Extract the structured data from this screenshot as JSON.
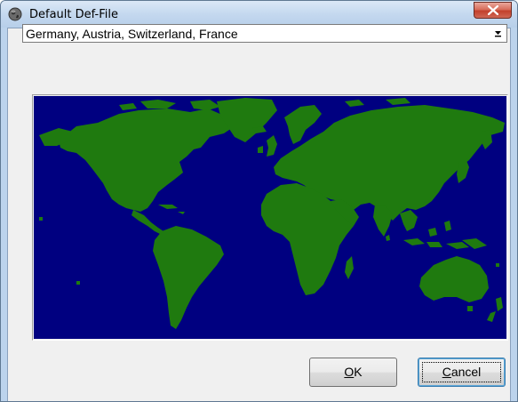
{
  "window": {
    "title": "Default Def-File",
    "icon": "globe-icon",
    "close_icon": "close-icon"
  },
  "region_select": {
    "value": "Germany, Austria, Switzerland, France",
    "arrow_icon": "dropdown-arrow-icon"
  },
  "map": {
    "ocean_color": "#000080",
    "land_color": "#1f7a0f"
  },
  "buttons": {
    "ok_accel": "O",
    "ok_rest": "K",
    "cancel_accel": "C",
    "cancel_rest": "ancel"
  }
}
